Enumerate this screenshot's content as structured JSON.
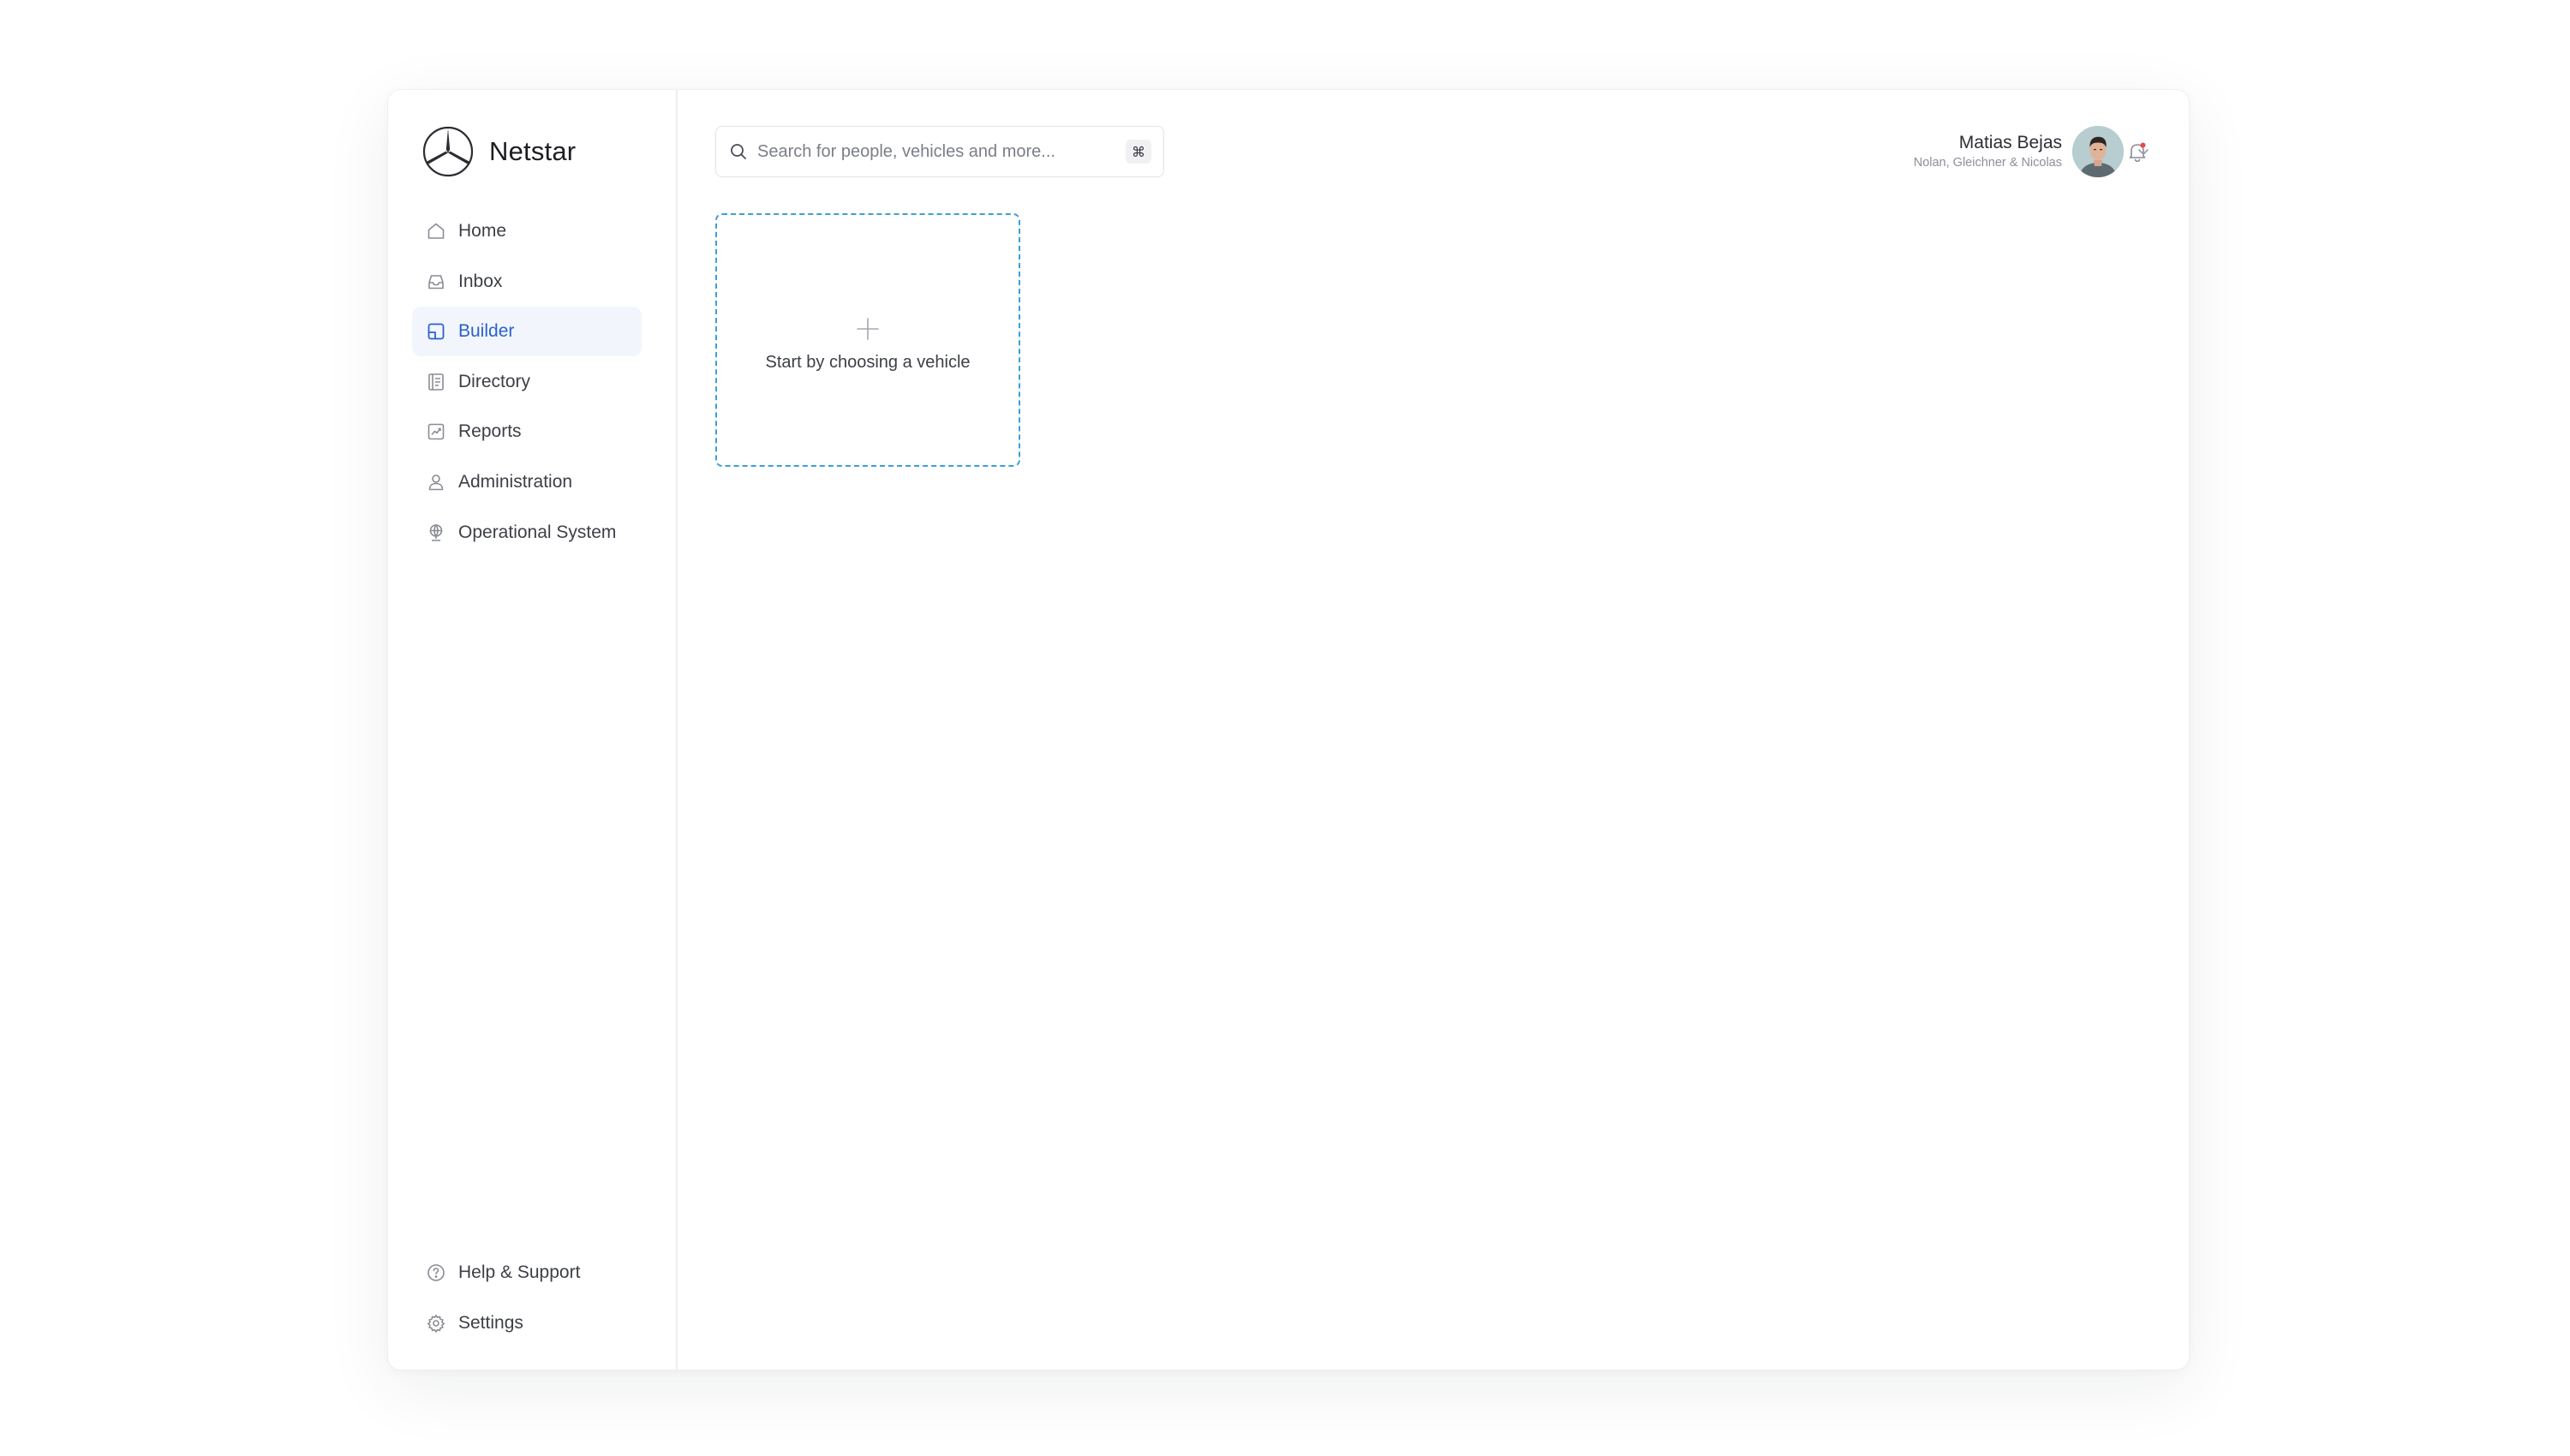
{
  "brand": {
    "name": "Netstar",
    "logo_icon": "mercedes-star-logo"
  },
  "sidebar": {
    "items": [
      {
        "label": "Home",
        "icon": "home-icon",
        "active": false
      },
      {
        "label": "Inbox",
        "icon": "inbox-icon",
        "active": false
      },
      {
        "label": "Builder",
        "icon": "builder-icon",
        "active": true
      },
      {
        "label": "Directory",
        "icon": "directory-icon",
        "active": false
      },
      {
        "label": "Reports",
        "icon": "reports-icon",
        "active": false
      },
      {
        "label": "Administration",
        "icon": "user-icon",
        "active": false
      },
      {
        "label": "Operational System",
        "icon": "globe-icon",
        "active": false
      }
    ],
    "bottom_items": [
      {
        "label": "Help & Support",
        "icon": "help-icon"
      },
      {
        "label": "Settings",
        "icon": "gear-icon"
      }
    ]
  },
  "header": {
    "search": {
      "placeholder": "Search for people, vehicles and more...",
      "value": "",
      "shortcut": "⌘"
    },
    "notifications": {
      "has_unread": true,
      "dot_color": "#e5484d"
    },
    "user": {
      "name": "Matias Bejas",
      "organization": "Nolan, Gleichner & Nicolas"
    }
  },
  "builder": {
    "empty_card_label": "Start by choosing a vehicle"
  },
  "colors": {
    "accent": "#2b5fd1",
    "active_bg": "#f2f6fc",
    "dashed_border": "#3b9fd8",
    "text": "#3d3f47",
    "muted": "#8d8f98"
  }
}
